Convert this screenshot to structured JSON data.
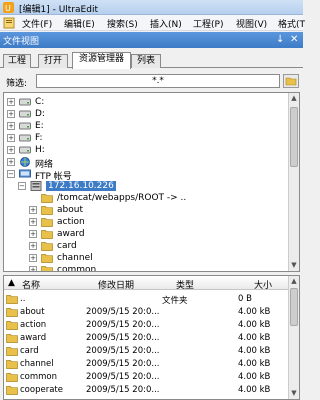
{
  "window": {
    "title": "[编辑1] - UltraEdit"
  },
  "menu": {
    "items": [
      "文件(F)",
      "编辑(E)",
      "搜索(S)",
      "插入(N)",
      "工程(P)",
      "视图(V)",
      "格式(T"
    ]
  },
  "panel": {
    "title": "文件视图",
    "pin_glyph": "↓",
    "close_glyph": "✕"
  },
  "tabs": [
    "工程",
    "打开",
    "资源管理器",
    "列表"
  ],
  "active_tab": "资源管理器",
  "filter": {
    "label": "筛选:",
    "value": "*.*"
  },
  "tree": {
    "drives": [
      "C:",
      "D:",
      "E:",
      "F:",
      "H:"
    ],
    "network_label": "网络",
    "ftp_label": "FTP 帐号",
    "server_label": "172.16.10.226",
    "path_label": "/tomcat/webapps/ROOT -> ..",
    "folders": [
      "about",
      "action",
      "award",
      "card",
      "channel",
      "common"
    ]
  },
  "list": {
    "columns": {
      "name": "名称",
      "date": "修改日期",
      "type": "类型",
      "size": "大小"
    },
    "rows": [
      {
        "name": "..",
        "date": "",
        "type": "文件夹",
        "size": "0 B"
      },
      {
        "name": "about",
        "date": "2009/5/15 20:0...",
        "type": "",
        "size": "4.00 kB"
      },
      {
        "name": "action",
        "date": "2009/5/15 20:0...",
        "type": "",
        "size": "4.00 kB"
      },
      {
        "name": "award",
        "date": "2009/5/15 20:0...",
        "type": "",
        "size": "4.00 kB"
      },
      {
        "name": "card",
        "date": "2009/5/15 20:0...",
        "type": "",
        "size": "4.00 kB"
      },
      {
        "name": "channel",
        "date": "2009/5/15 20:0...",
        "type": "",
        "size": "4.00 kB"
      },
      {
        "name": "common",
        "date": "2009/5/15 20:0...",
        "type": "",
        "size": "4.00 kB"
      },
      {
        "name": "cooperate",
        "date": "2009/5/15 20:0...",
        "type": "",
        "size": "4.00 kB"
      }
    ]
  },
  "icons": {
    "drive": "drive-icon",
    "network": "network-icon",
    "ftp": "ftp-icon",
    "folder": "folder-icon"
  },
  "colors": {
    "selection": "#3d7bc7",
    "panel_header": "#4a86d0",
    "folder": "#e8c04a"
  }
}
